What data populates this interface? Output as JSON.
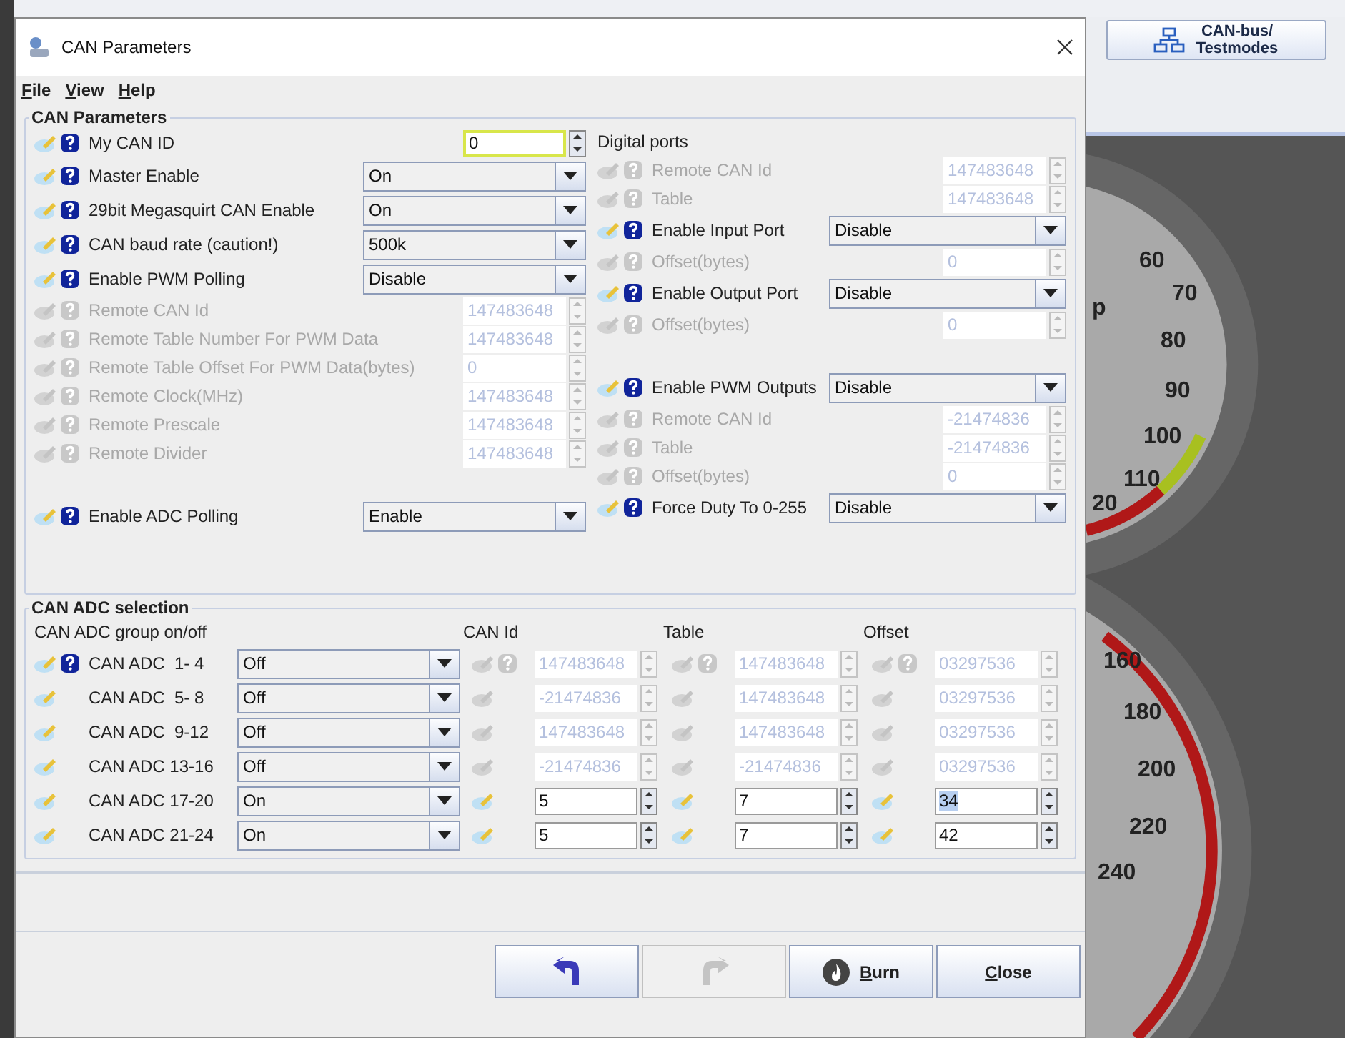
{
  "background": {
    "toolbar_button": {
      "label_lines": [
        "CAN-bus/",
        "Testmodes"
      ]
    },
    "gauges": [
      {
        "labels": [
          "60",
          "70",
          "80",
          "90",
          "100",
          "110",
          "20",
          "p"
        ]
      },
      {
        "labels": [
          "160",
          "180",
          "200",
          "220",
          "240"
        ]
      }
    ]
  },
  "window": {
    "title": "CAN Parameters"
  },
  "menu": [
    "File",
    "View",
    "Help"
  ],
  "parameters": {
    "title": "CAN Parameters",
    "left_rows": [
      {
        "kind": "spinner",
        "label": "My CAN ID",
        "value": "0",
        "disabled": false,
        "focused": true
      },
      {
        "kind": "dropdown",
        "label": "Master Enable",
        "value": "On"
      },
      {
        "kind": "dropdown",
        "label": "29bit Megasquirt CAN Enable",
        "value": "On"
      },
      {
        "kind": "dropdown",
        "label": "CAN baud rate (caution!)",
        "value": "500k"
      },
      {
        "kind": "dropdown",
        "label": "Enable PWM Polling",
        "value": "Disable"
      },
      {
        "kind": "spinner",
        "label": "Remote CAN Id",
        "value": "147483648",
        "disabled": true,
        "focused": false
      },
      {
        "kind": "spinner",
        "label": "Remote Table Number For PWM Data",
        "value": "147483648",
        "disabled": true,
        "focused": false
      },
      {
        "kind": "spinner",
        "label": "Remote Table Offset For PWM Data(bytes)",
        "value": "0",
        "disabled": true,
        "focused": false
      },
      {
        "kind": "spinner",
        "label": "Remote Clock(MHz)",
        "value": "147483648",
        "disabled": true,
        "focused": false
      },
      {
        "kind": "spinner",
        "label": "Remote Prescale",
        "value": "147483648",
        "disabled": true,
        "focused": false
      },
      {
        "kind": "spinner",
        "label": "Remote Divider",
        "value": "147483648",
        "disabled": true,
        "focused": false
      },
      {
        "kind": "gap"
      },
      {
        "kind": "dropdown",
        "label": "Enable ADC Polling",
        "value": "Enable"
      }
    ],
    "right_heading": "Digital ports",
    "right_rows": [
      {
        "kind": "spinner",
        "label": "Remote CAN Id",
        "value": "147483648",
        "disabled": true,
        "focused": false
      },
      {
        "kind": "spinner",
        "label": "Table",
        "value": "147483648",
        "disabled": true,
        "focused": false
      },
      {
        "kind": "dropdown",
        "label": "Enable Input Port",
        "value": "Disable"
      },
      {
        "kind": "spinner",
        "label": "Offset(bytes)",
        "value": "0",
        "disabled": true,
        "focused": false
      },
      {
        "kind": "dropdown",
        "label": "Enable Output Port",
        "value": "Disable"
      },
      {
        "kind": "spinner",
        "label": "Offset(bytes)",
        "value": "0",
        "disabled": true,
        "focused": false
      },
      {
        "kind": "gap"
      },
      {
        "kind": "dropdown",
        "label": "Enable PWM Outputs",
        "value": "Disable"
      },
      {
        "kind": "spinner",
        "label": "Remote CAN Id",
        "value": "-21474836",
        "disabled": true,
        "focused": false
      },
      {
        "kind": "spinner",
        "label": "Table",
        "value": "-21474836",
        "disabled": true,
        "focused": false
      },
      {
        "kind": "spinner",
        "label": "Offset(bytes)",
        "value": "0",
        "disabled": true,
        "focused": false
      },
      {
        "kind": "dropdown",
        "label": "Force Duty To 0-255",
        "value": "Disable"
      }
    ]
  },
  "adc": {
    "title": "CAN ADC selection",
    "columns": [
      "CAN ADC group on/off",
      "CAN Id",
      "Table",
      "Offset"
    ],
    "rows": [
      {
        "label": "CAN ADC  1- 4",
        "help": true,
        "group": "Off",
        "cells": [
          {
            "value": "147483648",
            "disabled": true,
            "help": true,
            "highlighted": false
          },
          {
            "value": "147483648",
            "disabled": true,
            "help": true,
            "highlighted": false
          },
          {
            "value": "03297536",
            "disabled": true,
            "help": true,
            "highlighted": false
          }
        ]
      },
      {
        "label": "CAN ADC  5- 8",
        "help": false,
        "group": "Off",
        "cells": [
          {
            "value": "-21474836",
            "disabled": true,
            "help": false,
            "highlighted": false
          },
          {
            "value": "147483648",
            "disabled": true,
            "help": false,
            "highlighted": false
          },
          {
            "value": "03297536",
            "disabled": true,
            "help": false,
            "highlighted": false
          }
        ]
      },
      {
        "label": "CAN ADC  9-12",
        "help": false,
        "group": "Off",
        "cells": [
          {
            "value": "147483648",
            "disabled": true,
            "help": false,
            "highlighted": false
          },
          {
            "value": "147483648",
            "disabled": true,
            "help": false,
            "highlighted": false
          },
          {
            "value": "03297536",
            "disabled": true,
            "help": false,
            "highlighted": false
          }
        ]
      },
      {
        "label": "CAN ADC 13-16",
        "help": false,
        "group": "Off",
        "cells": [
          {
            "value": "-21474836",
            "disabled": true,
            "help": false,
            "highlighted": false
          },
          {
            "value": "-21474836",
            "disabled": true,
            "help": false,
            "highlighted": false
          },
          {
            "value": "03297536",
            "disabled": true,
            "help": false,
            "highlighted": false
          }
        ]
      },
      {
        "label": "CAN ADC 17-20",
        "help": false,
        "group": "On",
        "cells": [
          {
            "value": "5",
            "disabled": false,
            "help": false,
            "highlighted": false
          },
          {
            "value": "7",
            "disabled": false,
            "help": false,
            "highlighted": false
          },
          {
            "value": "34",
            "disabled": false,
            "help": false,
            "highlighted": true
          }
        ]
      },
      {
        "label": "CAN ADC 21-24",
        "help": false,
        "group": "On",
        "cells": [
          {
            "value": "5",
            "disabled": false,
            "help": false,
            "highlighted": false
          },
          {
            "value": "7",
            "disabled": false,
            "help": false,
            "highlighted": false
          },
          {
            "value": "42",
            "disabled": false,
            "help": false,
            "highlighted": false
          }
        ]
      }
    ]
  },
  "buttons": [
    {
      "kind": "undo",
      "disabled": false
    },
    {
      "kind": "redo",
      "disabled": true
    },
    {
      "kind": "burn",
      "label": "Burn",
      "disabled": false
    },
    {
      "kind": "close",
      "label": "Close",
      "disabled": false
    }
  ]
}
